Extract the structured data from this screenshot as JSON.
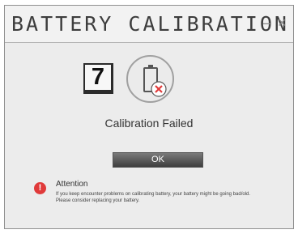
{
  "window": {
    "title": "BATTERY CALIBRATION",
    "minimize_glyph": "–",
    "close_glyph": "×"
  },
  "step": {
    "number": "7"
  },
  "status": {
    "icon": "battery-failed-icon",
    "text": "Calibration Failed"
  },
  "ok_button": {
    "label": "OK"
  },
  "attention": {
    "icon": "exclamation-icon",
    "icon_glyph": "!",
    "title": "Attention",
    "line1": "If you keep encounter problems on calibrating battery, your battery might be going bad/old.",
    "line2": "Please consider replacing your battery."
  },
  "colors": {
    "alert_red": "#e03a3a",
    "button_dark": "#3e3e3e",
    "background": "#ececec"
  }
}
